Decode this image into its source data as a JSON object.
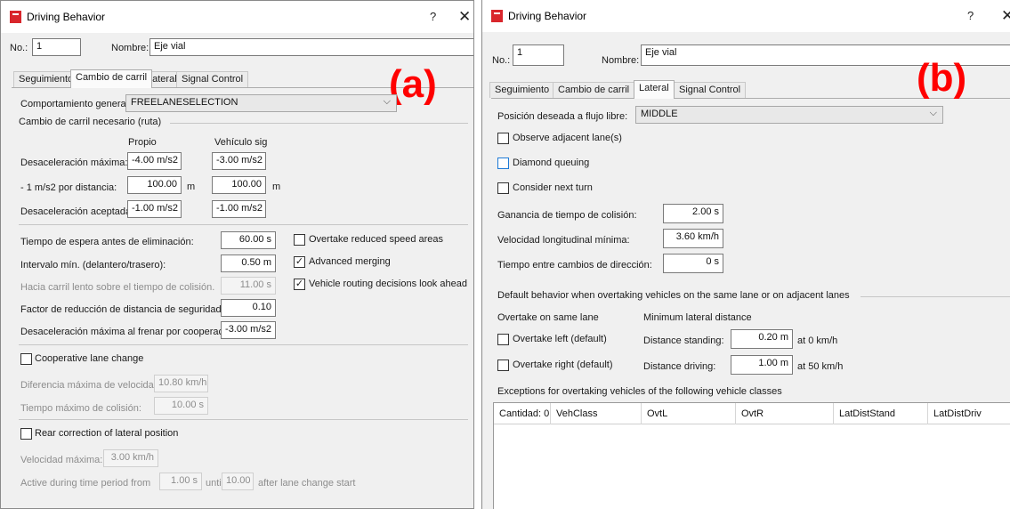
{
  "panel_a": {
    "tag": "(a)",
    "window_title": "Driving Behavior",
    "help_glyph": "?",
    "close_glyph": "✕",
    "no_label": "No.:",
    "no_value": "1",
    "nombre_label": "Nombre:",
    "nombre_value": "Eje vial",
    "tabs": [
      "Seguimiento",
      "Cambio de carril",
      "Lateral",
      "Signal Control"
    ],
    "active_tab": "Cambio de carril",
    "general_label": "Comportamiento general:",
    "general_value": "FREELANESELECTION",
    "section_ruta": "Cambio de carril necesario (ruta)",
    "col_propio": "Propio",
    "col_vehiculo": "Vehículo sig",
    "decel_max_label": "Desaceleración máxima:",
    "decel_max_propio": "-4.00 m/s2",
    "decel_max_veh": "-3.00 m/s2",
    "per_dist_label": "- 1 m/s2 por distancia:",
    "per_dist_propio": "100.00",
    "per_dist_veh": "100.00",
    "unit_m": "m",
    "decel_acc_label": "Desaceleración aceptada:",
    "decel_acc_propio": "-1.00 m/s2",
    "decel_acc_veh": "-1.00 m/s2",
    "espera_label": "Tiempo de espera antes de eliminación:",
    "espera_value": "60.00 s",
    "intervalo_label": "Intervalo mín. (delantero/trasero):",
    "intervalo_value": "0.50 m",
    "hacia_label": "Hacia carril lento sobre el tiempo de colisión.",
    "hacia_value": "11.00 s",
    "factor_label": "Factor de reducción de distancia de seguridad:",
    "factor_value": "0.10",
    "coop_decel_label": "Desaceleración máxima al frenar por cooperación:",
    "coop_decel_value": "-3.00 m/s2",
    "chk_overtake_reduced": "Overtake reduced speed areas",
    "chk_advanced_merging": "Advanced merging",
    "chk_vehicle_routing": "Vehicle routing decisions look ahead",
    "chk_coop_lane": "Cooperative lane change",
    "dif_vel_label": "Diferencia máxima de velocidad:",
    "dif_vel_value": "10.80 km/h",
    "tiempo_col_label": "Tiempo máximo de colisión:",
    "tiempo_col_value": "10.00 s",
    "chk_rear": "Rear correction of lateral position",
    "vel_max_label": "Velocidad máxima:",
    "vel_max_value": "3.00 km/h",
    "active_label": "Active during time period from",
    "active_from": "1.00 s",
    "until_label": "until",
    "active_until": "10.00 s",
    "after_label": "after lane change start",
    "checkmark": "✓"
  },
  "panel_b": {
    "tag": "(b)",
    "window_title": "Driving Behavior",
    "help_glyph": "?",
    "close_glyph": "✕",
    "no_label": "No.:",
    "no_value": "1",
    "nombre_label": "Nombre:",
    "nombre_value": "Eje vial",
    "tabs": [
      "Seguimiento",
      "Cambio de carril",
      "Lateral",
      "Signal Control"
    ],
    "active_tab": "Lateral",
    "posicion_label": "Posición deseada a flujo libre:",
    "posicion_value": "MIDDLE",
    "chk_observe": "Observe adjacent lane(s)",
    "chk_diamond": "Diamond queuing",
    "chk_next_turn": "Consider next turn",
    "ganancia_label": "Ganancia de tiempo de colisión:",
    "ganancia_value": "2.00 s",
    "vel_long_label": "Velocidad longitudinal mínima:",
    "vel_long_value": "3.60 km/h",
    "tiempo_dir_label": "Tiempo entre cambios de dirección:",
    "tiempo_dir_value": "0 s",
    "default_behavior": "Default behavior when overtaking vehicles on the same lane or on adjacent lanes",
    "overtake_same": "Overtake on same lane",
    "min_lateral": "Minimum lateral distance",
    "chk_left": "Overtake left (default)",
    "chk_right": "Overtake right (default)",
    "dist_standing_label": "Distance standing:",
    "dist_standing_value": "0.20 m",
    "at_0": "at 0 km/h",
    "dist_driving_label": "Distance driving:",
    "dist_driving_value": "1.00 m",
    "at_50": "at 50 km/h",
    "exceptions_label": "Exceptions for overtaking vehicles of the following vehicle classes",
    "grid_columns": [
      "Cantidad: 0",
      "VehClass",
      "OvtL",
      "OvtR",
      "LatDistStand",
      "LatDistDriv"
    ]
  },
  "colors": {
    "tag_red": "#ff0000",
    "app_icon_red": "#d9262c",
    "diamond_border_blue": "#1e7ad6"
  }
}
